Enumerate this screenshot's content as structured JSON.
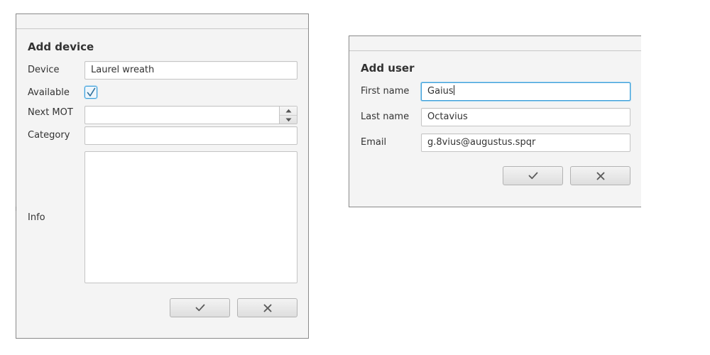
{
  "add_device": {
    "title": "Add device",
    "device_label": "Device",
    "device_value": "Laurel wreath",
    "available_label": "Available",
    "available_checked": true,
    "next_mot_label": "Next MOT",
    "next_mot_value": "",
    "category_label": "Category",
    "category_value": "",
    "info_label": "Info",
    "info_value": "",
    "confirm_icon": "check-icon",
    "cancel_icon": "close-icon"
  },
  "add_user": {
    "title": "Add user",
    "first_name_label": "First name",
    "first_name_value": "Gaius",
    "last_name_label": "Last name",
    "last_name_value": "Octavius",
    "email_label": "Email",
    "email_value": "g.8vius@augustus.spqr",
    "confirm_icon": "check-icon",
    "cancel_icon": "close-icon"
  },
  "colors": {
    "dialog_background": "#f4f4f4",
    "focus_accent": "#3c9ed8",
    "field_border": "#c4c4c4"
  }
}
